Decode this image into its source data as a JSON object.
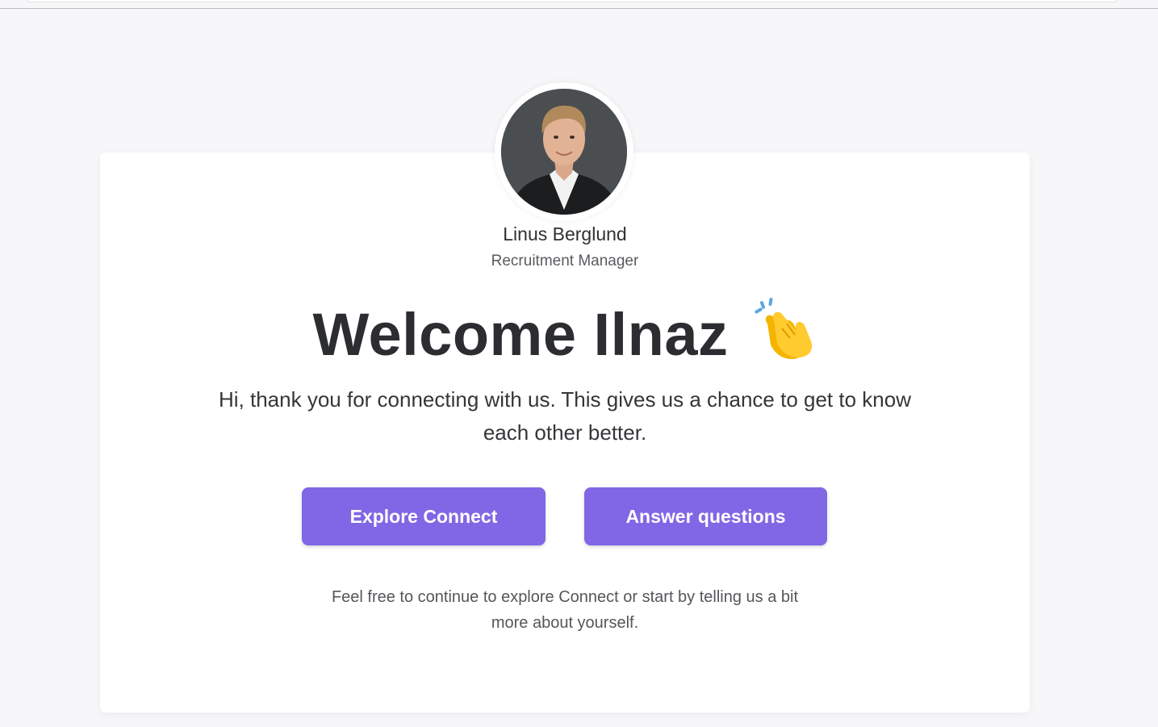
{
  "profile": {
    "name": "Linus Berglund",
    "role": "Recruitment Manager",
    "avatar_icon": "person-photo"
  },
  "welcome": {
    "headline": "Welcome Ilnaz",
    "emoji_icon": "clapping-hands-icon",
    "intro": "Hi, thank you for connecting with us. This gives us a chance to get to know each other better."
  },
  "actions": {
    "explore_label": "Explore Connect",
    "answer_label": "Answer questions"
  },
  "footnote": "Feel free to continue to explore Connect or start by telling us a bit more about yourself.",
  "colors": {
    "accent": "#8167e5",
    "background": "#f7f7f9",
    "card": "#ffffff",
    "text": "#2c2d31"
  }
}
